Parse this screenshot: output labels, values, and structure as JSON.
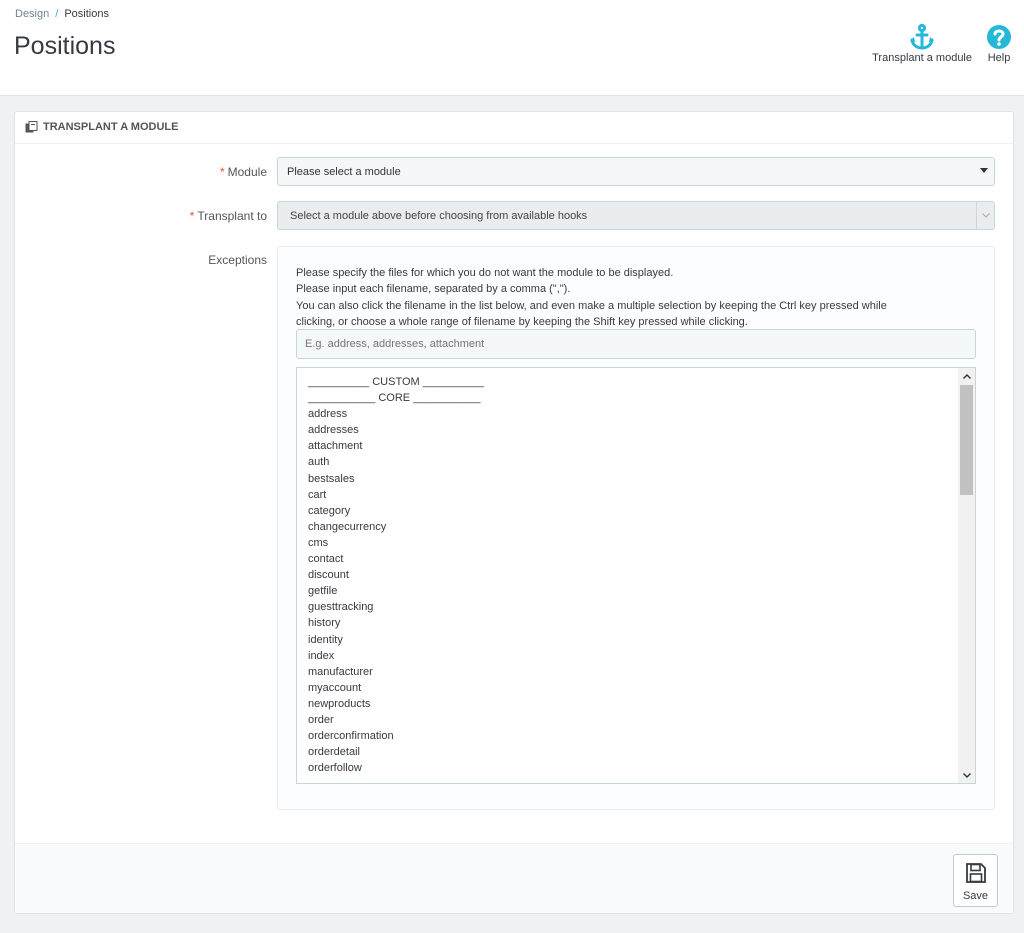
{
  "breadcrumb": {
    "parent": "Design",
    "separator": "/",
    "current": "Positions"
  },
  "page_title": "Positions",
  "toolbar": {
    "transplant_label": "Transplant a module",
    "help_label": "Help",
    "accent_color": "#25b9d7"
  },
  "panel": {
    "heading": "TRANSPLANT A MODULE",
    "module": {
      "label": "Module",
      "required_mark": "*",
      "value": "Please select a module"
    },
    "transplant_to": {
      "label": "Transplant to",
      "required_mark": "*",
      "value": "Select a module above before choosing from available hooks"
    },
    "exceptions": {
      "label": "Exceptions",
      "help_lines": [
        "Please specify the files for which you do not want the module to be displayed.",
        "Please input each filename, separated by a comma (\",\").",
        "You can also click the filename in the list below, and even make a multiple selection by keeping the Ctrl key pressed while",
        "clicking, or choose a whole range of filename by keeping the Shift key pressed while clicking."
      ],
      "input_placeholder": "E.g. address, addresses, attachment",
      "list_items": [
        "__________ CUSTOM __________",
        "___________ CORE ___________",
        "address",
        "addresses",
        "attachment",
        "auth",
        "bestsales",
        "cart",
        "category",
        "changecurrency",
        "cms",
        "contact",
        "discount",
        "getfile",
        "guesttracking",
        "history",
        "identity",
        "index",
        "manufacturer",
        "myaccount",
        "newproducts",
        "order",
        "orderconfirmation",
        "orderdetail",
        "orderfollow"
      ]
    }
  },
  "footer": {
    "save_label": "Save"
  }
}
